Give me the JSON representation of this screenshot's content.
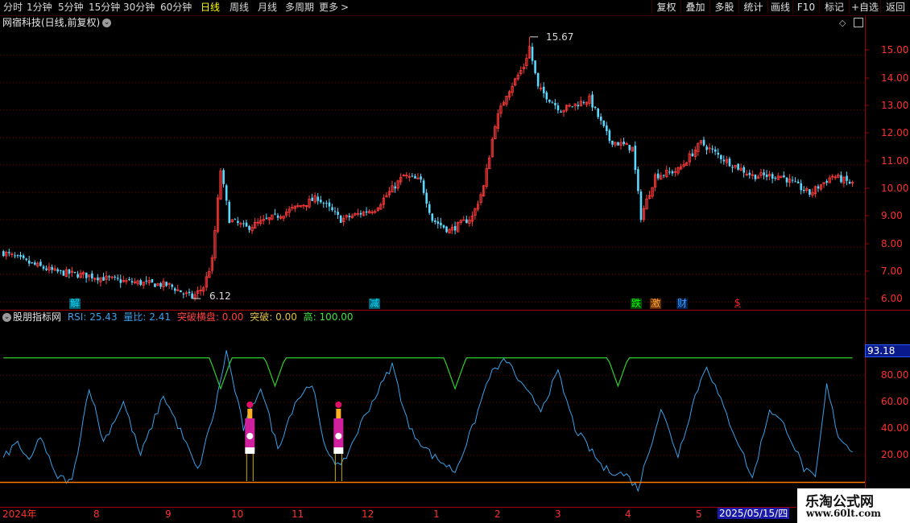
{
  "toolbar": {
    "periods": [
      "分时",
      "1分钟",
      "5分钟",
      "15分钟",
      "30分钟",
      "60分钟",
      "日线",
      "周线",
      "月线",
      "多周期",
      "更多"
    ],
    "active_period": "日线",
    "more_arrow": ">",
    "right_buttons": [
      "复权",
      "叠加",
      "多股",
      "统计",
      "画线",
      "F10",
      "标记",
      "+自选",
      "返回"
    ]
  },
  "main_chart": {
    "title": "网宿科技(日线,前复权)",
    "high_label": "15.67",
    "low_label": "6.12",
    "price_ticks": [
      "15.00",
      "14.00",
      "13.00",
      "12.00",
      "11.00",
      "10.00",
      "9.00",
      "8.00",
      "7.00",
      "6.00"
    ],
    "event_markers": [
      {
        "text": "解",
        "color": "#00d8ff",
        "bg": "#006070"
      },
      {
        "text": "减",
        "color": "#00d8ff",
        "bg": "#006070"
      },
      {
        "text": "跌",
        "color": "#00ff00",
        "bg": "#004a00"
      },
      {
        "text": "激",
        "color": "#ffb030",
        "bg": "#6a2a00"
      },
      {
        "text": "财",
        "color": "#40a0ff",
        "bg": "#002050"
      },
      {
        "text": "$",
        "color": "#ff2020",
        "bg": "#000000"
      }
    ]
  },
  "indicator": {
    "name": "股朋指标网",
    "rsi_label": "RSI:",
    "rsi_value": "25.43",
    "vol_label": "量比:",
    "vol_value": "2.41",
    "break_label": "突破横盘:",
    "break_value": "0.00",
    "tp_label": "突破:",
    "tp_value": "0.00",
    "high_label": "高:",
    "high_value": "100.00",
    "current_badge": "93.18",
    "ticks": [
      "80.00",
      "60.00",
      "40.00",
      "20.00"
    ]
  },
  "date_axis": {
    "labels": [
      "2024年",
      "8",
      "9",
      "10",
      "11",
      "12",
      "1",
      "2",
      "3",
      "4",
      "5"
    ],
    "current_date": "2025/05/15/四"
  },
  "watermark": {
    "title": "乐淘公式网",
    "url": "www.60lt.com"
  },
  "colors": {
    "up": "#ff3a3a",
    "down": "#5ad8ff",
    "rsi": "#3aa0e8",
    "threshold": "#2ed02e",
    "base": "#ff7a00",
    "grid": "#7a0000",
    "axis_text": "#ff3030"
  },
  "icons": {
    "settings": "chevron-down-icon",
    "diamond": "diamond-icon",
    "panel": "window-icon"
  },
  "chart_data": {
    "type": "candlestick",
    "title": "网宿科技(日线,前复权)",
    "ylim": [
      5.8,
      15.9
    ],
    "y_ticks": [
      6,
      7,
      8,
      9,
      10,
      11,
      12,
      13,
      14,
      15
    ],
    "x_month_labels": [
      "2024年",
      "8",
      "9",
      "10",
      "11",
      "12",
      "1",
      "2",
      "3",
      "4",
      "5"
    ],
    "close_anchors": [
      {
        "t": 0,
        "c": 7.8
      },
      {
        "t": 8,
        "c": 7.45
      },
      {
        "t": 18,
        "c": 7.1
      },
      {
        "t": 30,
        "c": 6.95
      },
      {
        "t": 42,
        "c": 6.75
      },
      {
        "t": 58,
        "c": 6.6
      },
      {
        "t": 66,
        "c": 6.15
      },
      {
        "t": 70,
        "c": 6.55
      },
      {
        "t": 73,
        "c": 7.5
      },
      {
        "t": 76,
        "c": 10.8
      },
      {
        "t": 79,
        "c": 9.0
      },
      {
        "t": 85,
        "c": 8.7
      },
      {
        "t": 95,
        "c": 9.1
      },
      {
        "t": 110,
        "c": 9.8
      },
      {
        "t": 118,
        "c": 9.0
      },
      {
        "t": 130,
        "c": 9.4
      },
      {
        "t": 140,
        "c": 10.6
      },
      {
        "t": 146,
        "c": 10.4
      },
      {
        "t": 150,
        "c": 9.0
      },
      {
        "t": 156,
        "c": 8.6
      },
      {
        "t": 164,
        "c": 9.1
      },
      {
        "t": 168,
        "c": 10.2
      },
      {
        "t": 172,
        "c": 12.5
      },
      {
        "t": 176,
        "c": 13.6
      },
      {
        "t": 182,
        "c": 14.6
      },
      {
        "t": 184,
        "c": 15.3
      },
      {
        "t": 187,
        "c": 13.8
      },
      {
        "t": 195,
        "c": 13.0
      },
      {
        "t": 205,
        "c": 13.4
      },
      {
        "t": 212,
        "c": 11.9
      },
      {
        "t": 220,
        "c": 11.6
      },
      {
        "t": 223,
        "c": 9.1
      },
      {
        "t": 228,
        "c": 10.6
      },
      {
        "t": 236,
        "c": 10.8
      },
      {
        "t": 244,
        "c": 11.8
      },
      {
        "t": 252,
        "c": 11.2
      },
      {
        "t": 262,
        "c": 10.6
      },
      {
        "t": 272,
        "c": 10.6
      },
      {
        "t": 282,
        "c": 9.95
      },
      {
        "t": 290,
        "c": 10.6
      },
      {
        "t": 297,
        "c": 10.3
      }
    ],
    "high": 15.67,
    "low": 6.12
  },
  "indicator_data": {
    "type": "line",
    "ylim": [
      0,
      100
    ],
    "y_ticks": [
      20,
      40,
      60,
      80
    ],
    "rsi_latest": 25.43,
    "threshold_level": 93.18,
    "base_level": 0,
    "rsi_anchors": [
      {
        "t": 0,
        "v": 18
      },
      {
        "t": 5,
        "v": 30
      },
      {
        "t": 9,
        "v": 14
      },
      {
        "t": 13,
        "v": 35
      },
      {
        "t": 18,
        "v": 5
      },
      {
        "t": 24,
        "v": 0
      },
      {
        "t": 30,
        "v": 72
      },
      {
        "t": 35,
        "v": 30
      },
      {
        "t": 42,
        "v": 60
      },
      {
        "t": 48,
        "v": 20
      },
      {
        "t": 56,
        "v": 65
      },
      {
        "t": 62,
        "v": 38
      },
      {
        "t": 68,
        "v": 8
      },
      {
        "t": 74,
        "v": 55
      },
      {
        "t": 78,
        "v": 98
      },
      {
        "t": 84,
        "v": 40
      },
      {
        "t": 90,
        "v": 72
      },
      {
        "t": 96,
        "v": 25
      },
      {
        "t": 102,
        "v": 60
      },
      {
        "t": 108,
        "v": 75
      },
      {
        "t": 112,
        "v": 28
      },
      {
        "t": 118,
        "v": 10
      },
      {
        "t": 126,
        "v": 48
      },
      {
        "t": 136,
        "v": 88
      },
      {
        "t": 142,
        "v": 40
      },
      {
        "t": 150,
        "v": 20
      },
      {
        "t": 158,
        "v": 8
      },
      {
        "t": 164,
        "v": 40
      },
      {
        "t": 170,
        "v": 80
      },
      {
        "t": 176,
        "v": 92
      },
      {
        "t": 182,
        "v": 70
      },
      {
        "t": 188,
        "v": 55
      },
      {
        "t": 194,
        "v": 82
      },
      {
        "t": 200,
        "v": 40
      },
      {
        "t": 210,
        "v": 10
      },
      {
        "t": 218,
        "v": 5
      },
      {
        "t": 222,
        "v": -5
      },
      {
        "t": 230,
        "v": 55
      },
      {
        "t": 236,
        "v": 20
      },
      {
        "t": 242,
        "v": 65
      },
      {
        "t": 246,
        "v": 88
      },
      {
        "t": 252,
        "v": 55
      },
      {
        "t": 258,
        "v": 25
      },
      {
        "t": 262,
        "v": 2
      },
      {
        "t": 268,
        "v": 55
      },
      {
        "t": 274,
        "v": 40
      },
      {
        "t": 280,
        "v": 10
      },
      {
        "t": 284,
        "v": 2
      },
      {
        "t": 288,
        "v": 72
      },
      {
        "t": 292,
        "v": 35
      },
      {
        "t": 296,
        "v": 25
      }
    ],
    "threshold_dips": [
      {
        "t": 76,
        "v": 70
      },
      {
        "t": 95,
        "v": 72
      },
      {
        "t": 158,
        "v": 70
      },
      {
        "t": 215,
        "v": 72
      }
    ],
    "signals": [
      {
        "t": 86
      },
      {
        "t": 117
      }
    ]
  }
}
